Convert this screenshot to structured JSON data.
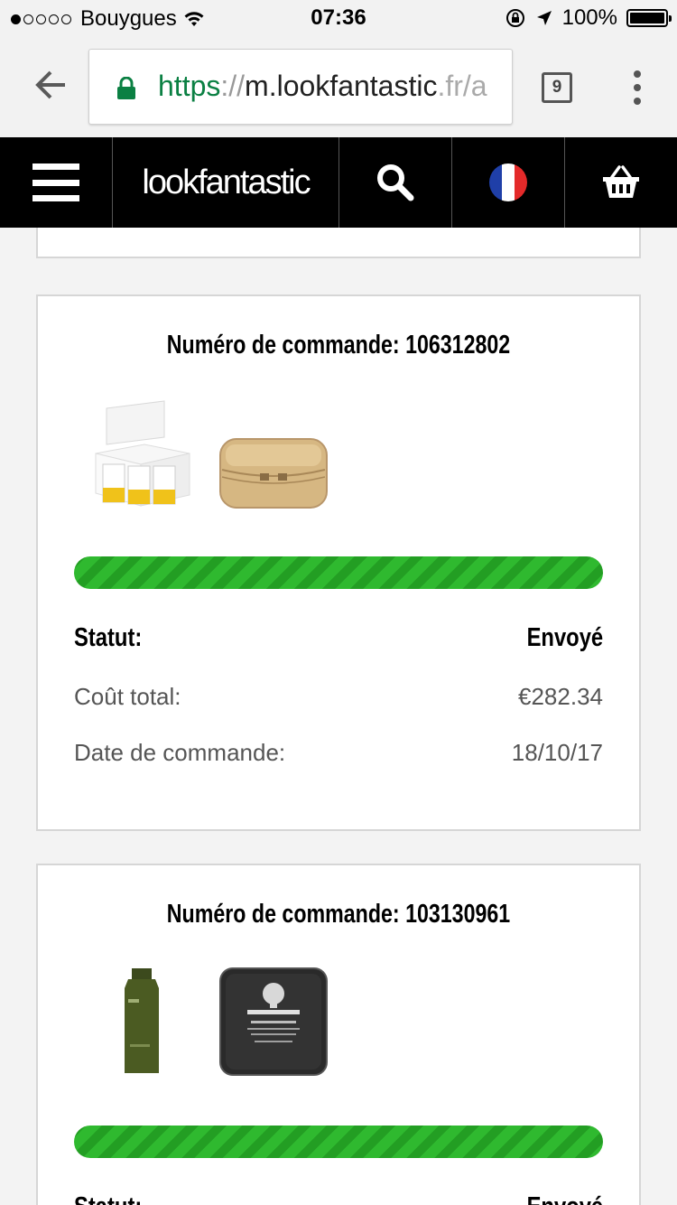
{
  "status_bar": {
    "carrier": "Bouygues",
    "time": "07:36",
    "battery": "100%",
    "signal_bars_filled": 1,
    "signal_bars_total": 5
  },
  "browser": {
    "url_scheme": "https",
    "url_separator": "://",
    "url_host": "m.lookfantastic",
    "url_tld": ".fr",
    "url_tail": "/a",
    "tab_count": "9"
  },
  "site_header": {
    "logo": "lookfantastic",
    "icons": [
      "menu-icon",
      "search-icon",
      "france-flag-icon",
      "basket-icon"
    ]
  },
  "orders": [
    {
      "title": "Numéro de commande: 106312802",
      "products": [
        "skincare-gift-box",
        "cosmetic-bag"
      ],
      "progress": 1.0,
      "status_label": "Statut:",
      "status_value": "Envoyé",
      "total_label": "Coût total:",
      "total_value": "€282.34",
      "date_label": "Date de commande:",
      "date_value": "18/10/17"
    },
    {
      "title": "Numéro de commande: 103130961",
      "products": [
        "green-lotion-bottle",
        "origins-charcoal-mask-sample"
      ],
      "progress": 1.0,
      "status_label": "Statut:",
      "status_value": "Envoyé"
    }
  ],
  "colors": {
    "progress_green": "#2fb92f",
    "https_green": "#0b8043",
    "header_bg": "#000000"
  }
}
